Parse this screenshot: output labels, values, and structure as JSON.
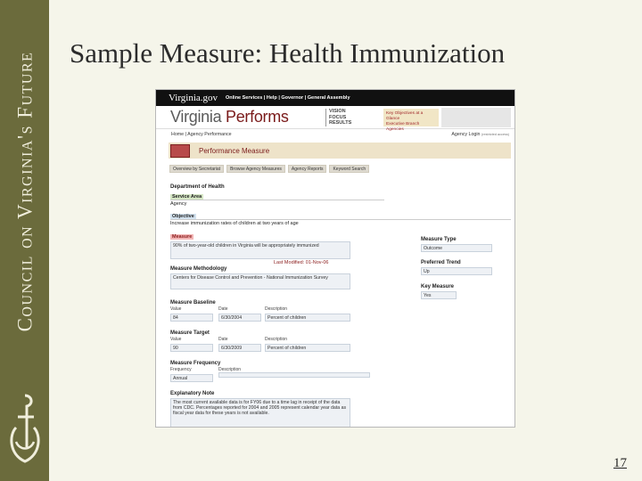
{
  "sidebar": {
    "text": "Council on Virginia's Future"
  },
  "slide": {
    "title": "Sample Measure:  Health Immunization",
    "page_number": "17"
  },
  "screenshot": {
    "topbar": {
      "logo": "Virginia.gov",
      "links": "Online Services | Help | Governor | General Assembly"
    },
    "banner": {
      "title_prefix": "Virginia ",
      "title_emph": "Performs",
      "vision": "VISION\nFOCUS\nRESULTS",
      "key_box": "Key Objectives at a Glance\nExecutive Branch Agencies"
    },
    "nav": {
      "left": "Home | Agency Performance",
      "right": "Agency Login",
      "right_small": "(restricted access)"
    },
    "pm_header": "Performance Measure",
    "tabs": [
      "Overview by Secretariat",
      "Browse Agency Measures",
      "Agency Reports",
      "Keyword Search"
    ],
    "department": "Department of Health",
    "service_area_label": "Service Area",
    "service_area_value": "Agency",
    "objective_label": "Objective",
    "objective_value": "Increase immunization rates of children at two years of age",
    "measure_label": "Measure",
    "measure_value": "90% of two-year-old children in Virginia will be appropriately immunized",
    "last_modified": "Last Modified: 01-Nov-06",
    "methodology_label": "Measure Methodology",
    "methodology_value": "Centers for Disease Control and Prevention - National Immunization Survey",
    "measure_type_label": "Measure Type",
    "measure_type_value": "Outcome",
    "trend_label": "Preferred Trend",
    "trend_value": "Up",
    "key_measure_label": "Key Measure",
    "key_measure_value": "Yes",
    "baseline": {
      "label": "Measure Baseline",
      "value_h": "Value",
      "date_h": "Date",
      "desc_h": "Description",
      "value": "84",
      "date": "6/30/2004",
      "desc": "Percent of children"
    },
    "target": {
      "label": "Measure Target",
      "value_h": "Value",
      "date_h": "Date",
      "desc_h": "Description",
      "value": "90",
      "date": "6/30/2009",
      "desc": "Percent of children"
    },
    "frequency": {
      "label": "Measure Frequency",
      "freq_h": "Frequency",
      "desc_h": "Description",
      "value": "Annual",
      "desc": ""
    },
    "note": {
      "label": "Explanatory Note",
      "value": "The most current available data is for FY06 due to a time lag in receipt of the data from CDC. Percentages reported for 2004 and 2005 represent calendar year data as fiscal year data for these years is not available."
    }
  }
}
